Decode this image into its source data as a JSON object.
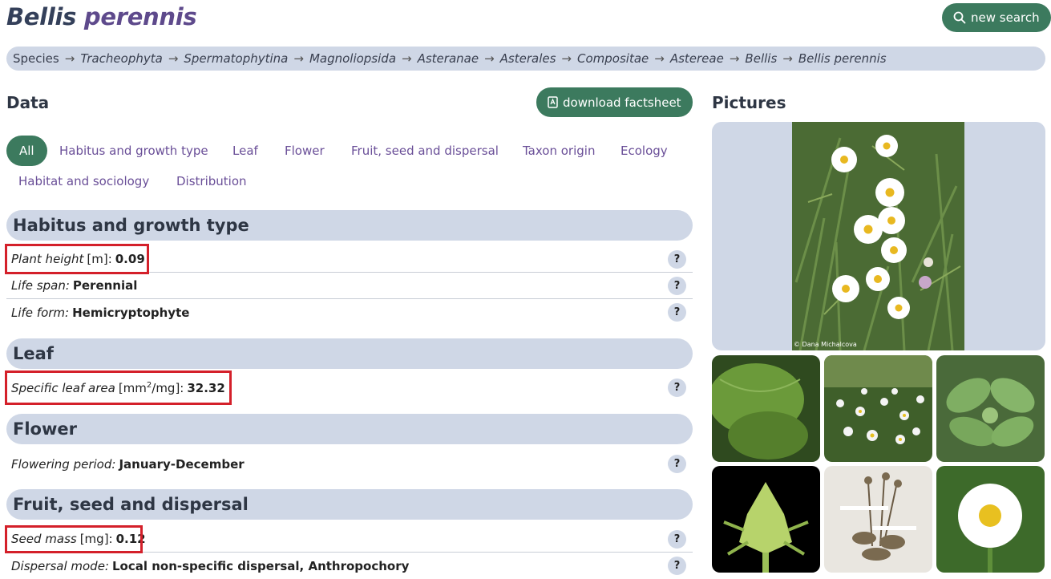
{
  "title": {
    "genus": "Bellis",
    "epithet": "perennis"
  },
  "new_search_label": "new search",
  "breadcrumb": [
    "Species",
    "Tracheophyta",
    "Spermatophytina",
    "Magnoliopsida",
    "Asteranae",
    "Asterales",
    "Compositae",
    "Astereae",
    "Bellis",
    "Bellis perennis"
  ],
  "breadcrumb_sep": "→",
  "data_heading": "Data",
  "download_label": "download factsheet",
  "pictures_heading": "Pictures",
  "filters": [
    "All",
    "Habitus and growth type",
    "Leaf",
    "Flower",
    "Fruit, seed and dispersal",
    "Taxon origin",
    "Ecology",
    "Habitat and sociology",
    "Distribution"
  ],
  "sections": {
    "habitus": {
      "title": "Habitus and growth type",
      "plant_height": {
        "label": "Plant height",
        "unit": "[m]:",
        "value": "0.09"
      },
      "life_span": {
        "label": "Life span:",
        "value": "Perennial"
      },
      "life_form": {
        "label": "Life form:",
        "value": "Hemicryptophyte"
      }
    },
    "leaf": {
      "title": "Leaf",
      "sla": {
        "label": "Specific leaf area",
        "unit_a": "[mm",
        "unit_sup": "2",
        "unit_b": "/mg]:",
        "value": "32.32"
      }
    },
    "flower": {
      "title": "Flower",
      "flowering": {
        "label": "Flowering period:",
        "value": "January-December"
      }
    },
    "fruit": {
      "title": "Fruit, seed and dispersal",
      "seed_mass": {
        "label": "Seed mass",
        "unit": "[mg]:",
        "value": "0.12"
      },
      "dispersal": {
        "label": "Dispersal mode:",
        "value": "Local non-specific dispersal, Anthropochory"
      }
    }
  },
  "help_label": "?",
  "main_picture_credit": "© Dana Michalcova",
  "colors": {
    "accent_green": "#3c7a5e",
    "pill_bg": "#cfd7e6",
    "link_purple": "#6a4f98",
    "highlight_red": "#d4202a"
  }
}
